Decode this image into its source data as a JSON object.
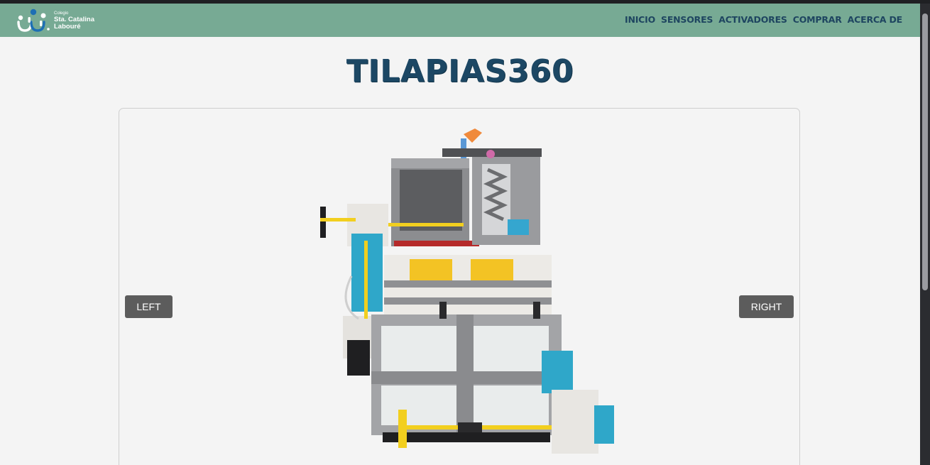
{
  "brand": {
    "small_label": "Colegio",
    "name_line1": "Sta. Catalina",
    "name_line2": "Labouré",
    "color": "#77aa94"
  },
  "nav": {
    "items": [
      {
        "label": "INICIO"
      },
      {
        "label": "SENSORES"
      },
      {
        "label": "ACTIVADORES"
      },
      {
        "label": "COMPRAR"
      },
      {
        "label": "ACERCA DE"
      }
    ]
  },
  "page": {
    "title": "TILAPIAS360",
    "title_color": "#1c4764"
  },
  "viewer": {
    "left_button": "LEFT",
    "right_button": "RIGHT",
    "image_icon": "lego-model-image"
  }
}
